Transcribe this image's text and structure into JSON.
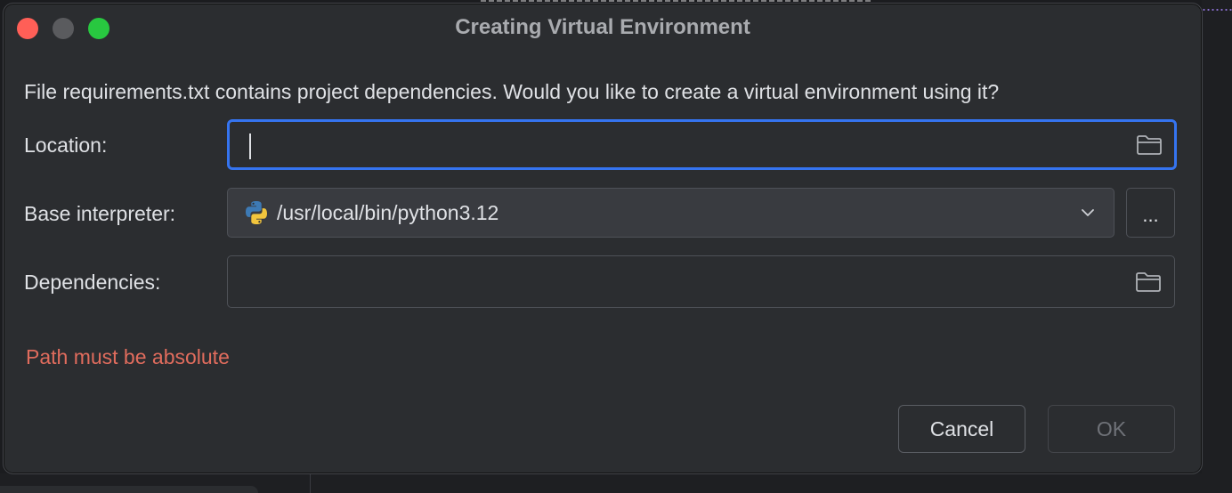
{
  "dialog": {
    "title": "Creating Virtual Environment",
    "message": "File requirements.txt contains project dependencies. Would you like to create a virtual environment using it?",
    "error": "Path must be absolute"
  },
  "location": {
    "label": "Location:",
    "value": "",
    "icon": "folder-icon"
  },
  "base_interpreter": {
    "label": "Base interpreter:",
    "value": "/usr/local/bin/python3.12",
    "icon": "python-icon",
    "browse_label": "..."
  },
  "dependencies": {
    "label": "Dependencies:",
    "value": "",
    "icon": "folder-icon"
  },
  "buttons": {
    "cancel": "Cancel",
    "ok": "OK"
  },
  "colors": {
    "close": "#ff5f57",
    "minimize": "#5a5b5e",
    "maximize": "#28c840",
    "focus_border": "#3574f0",
    "error_text": "#e06c5d"
  }
}
